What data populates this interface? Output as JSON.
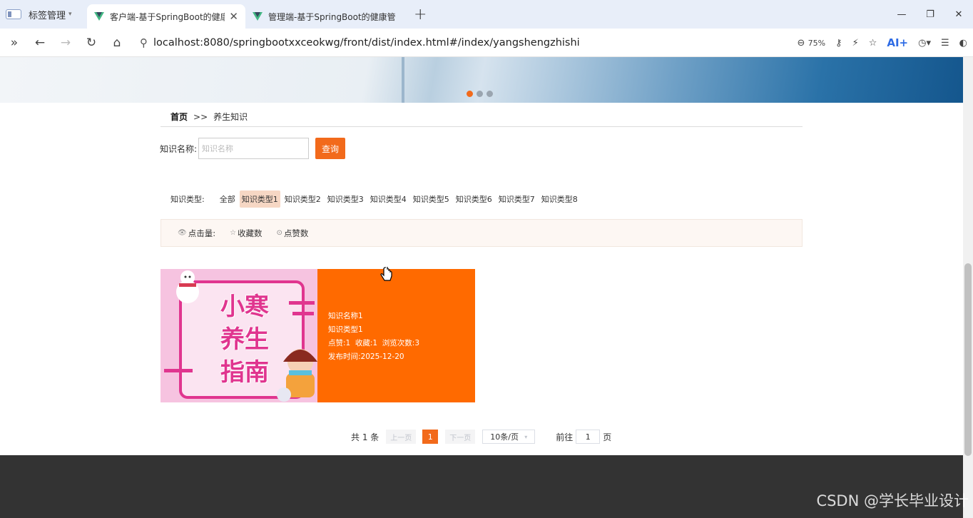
{
  "browser": {
    "tab_manager_label": "标签管理",
    "tabs": [
      {
        "title": "客户端-基于SpringBoot的健康",
        "active": true
      },
      {
        "title": "管理端-基于SpringBoot的健康管",
        "active": false
      }
    ],
    "url": "localhost:8080/springbootxxceokwg/front/dist/index.html#/index/yangshengzhishi",
    "zoom": "75%",
    "ai_label": "AI+"
  },
  "page": {
    "breadcrumb": {
      "home": "首页",
      "separator": ">>",
      "current": "养生知识"
    },
    "search": {
      "label": "知识名称:",
      "placeholder": "知识名称",
      "button": "查询"
    },
    "types": {
      "label": "知识类型:",
      "options": [
        "全部",
        "知识类型1",
        "知识类型2",
        "知识类型3",
        "知识类型4",
        "知识类型5",
        "知识类型6",
        "知识类型7",
        "知识类型8"
      ],
      "selected": "知识类型1"
    },
    "sort": {
      "clicks": "点击量:",
      "favorites": "收藏数",
      "likes": "点赞数"
    },
    "cards": [
      {
        "image_text": [
          "小寒",
          "养生",
          "指南"
        ],
        "name": "知识名称1",
        "type": "知识类型1",
        "stats": "点赞:1  收藏:1  浏览次数:3",
        "published": "发布时间:2025-12-20"
      }
    ],
    "pagination": {
      "total": "共 1 条",
      "prev": "上一页",
      "current": "1",
      "next": "下一页",
      "page_size": "10条/页",
      "goto_prefix": "前往",
      "goto_value": "1",
      "goto_suffix": "页"
    },
    "watermark": "CSDN @学长毕业设计"
  },
  "colors": {
    "accent": "#f26a1b",
    "card_info": "#ff6a00",
    "footer": "#333333"
  }
}
